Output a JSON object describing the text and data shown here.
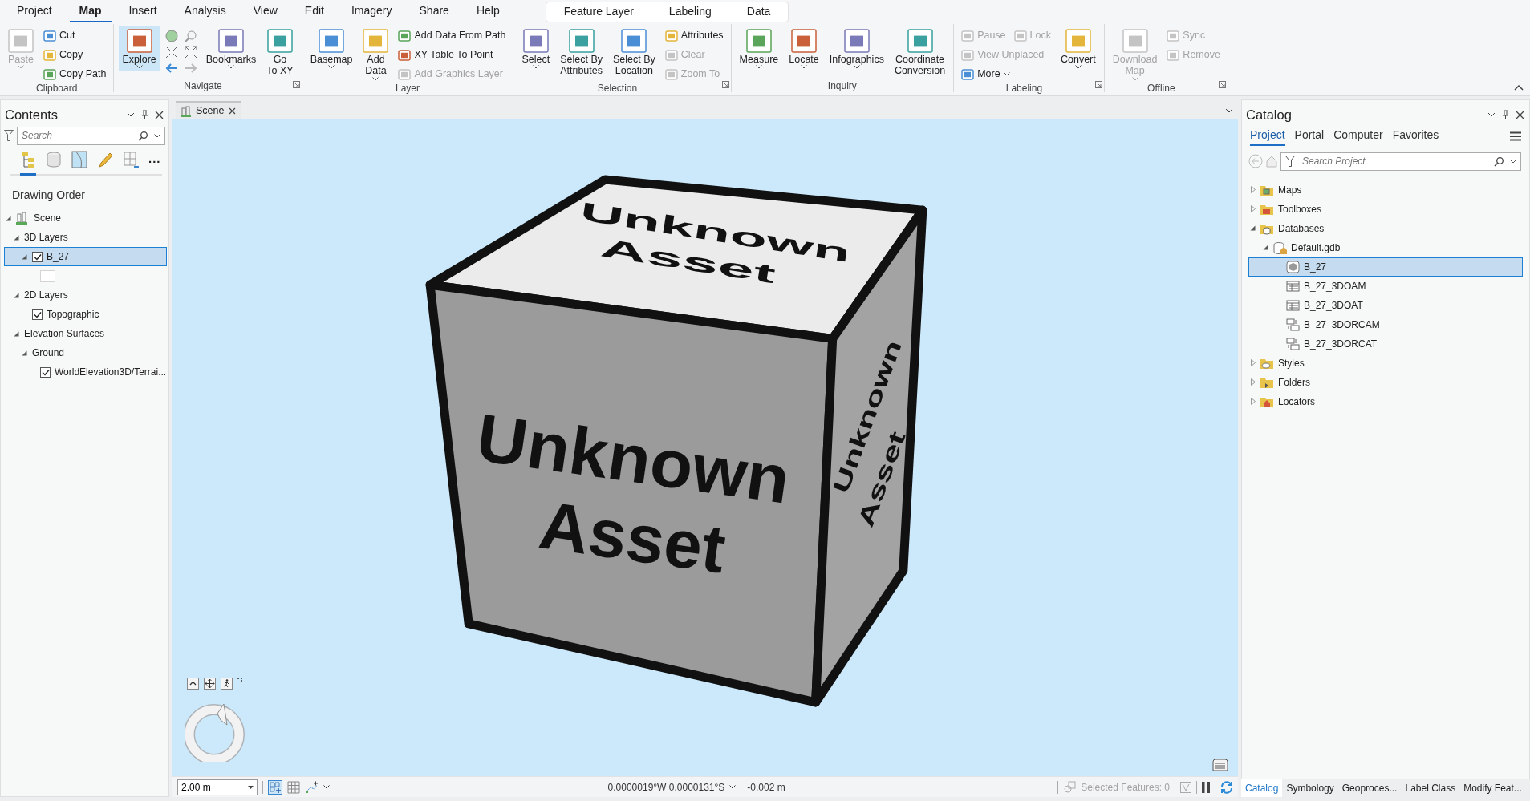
{
  "ribbon": {
    "tabs": [
      {
        "label": "Project",
        "selected": false
      },
      {
        "label": "Map",
        "selected": true
      },
      {
        "label": "Insert",
        "selected": false
      },
      {
        "label": "Analysis",
        "selected": false
      },
      {
        "label": "View",
        "selected": false
      },
      {
        "label": "Edit",
        "selected": false
      },
      {
        "label": "Imagery",
        "selected": false
      },
      {
        "label": "Share",
        "selected": false
      },
      {
        "label": "Help",
        "selected": false
      }
    ],
    "contextual_tabs": [
      {
        "label": "Feature Layer",
        "selected": false
      },
      {
        "label": "Labeling",
        "selected": false
      },
      {
        "label": "Data",
        "selected": false
      }
    ],
    "groups": [
      {
        "label": "Clipboard",
        "launcher": false,
        "controls": [
          {
            "kind": "large",
            "label": "Paste",
            "disabled": true,
            "dropdown": true,
            "active": false
          },
          {
            "kind": "stack",
            "rows": [
              [
                {
                  "label": "Cut",
                  "disabled": false,
                  "dropdown": false
                }
              ],
              [
                {
                  "label": "Copy",
                  "disabled": false,
                  "dropdown": false
                }
              ],
              [
                {
                  "label": "Copy Path",
                  "disabled": false,
                  "dropdown": false
                }
              ]
            ]
          }
        ]
      },
      {
        "label": "Navigate",
        "launcher": true,
        "controls": [
          {
            "kind": "large",
            "label": "Explore",
            "disabled": false,
            "dropdown": true,
            "active": true
          },
          {
            "kind": "nav-grid"
          },
          {
            "kind": "large",
            "label": "Bookmarks",
            "disabled": false,
            "dropdown": true,
            "active": false
          },
          {
            "kind": "large",
            "label": "Go\nTo XY",
            "disabled": false,
            "dropdown": false,
            "active": false
          }
        ]
      },
      {
        "label": "Layer",
        "launcher": false,
        "controls": [
          {
            "kind": "large",
            "label": "Basemap",
            "disabled": false,
            "dropdown": true,
            "active": false
          },
          {
            "kind": "large",
            "label": "Add\nData",
            "disabled": false,
            "dropdown": true,
            "active": false
          },
          {
            "kind": "stack",
            "rows": [
              [
                {
                  "label": "Add Data From Path",
                  "disabled": false,
                  "dropdown": false
                }
              ],
              [
                {
                  "label": "XY Table To Point",
                  "disabled": false,
                  "dropdown": false
                }
              ],
              [
                {
                  "label": "Add Graphics Layer",
                  "disabled": true,
                  "dropdown": false
                }
              ]
            ]
          }
        ]
      },
      {
        "label": "Selection",
        "launcher": true,
        "controls": [
          {
            "kind": "large",
            "label": "Select",
            "disabled": false,
            "dropdown": true,
            "active": false
          },
          {
            "kind": "large",
            "label": "Select By\nAttributes",
            "disabled": false,
            "dropdown": false,
            "active": false
          },
          {
            "kind": "large",
            "label": "Select By\nLocation",
            "disabled": false,
            "dropdown": false,
            "active": false
          },
          {
            "kind": "stack",
            "rows": [
              [
                {
                  "label": "Attributes",
                  "disabled": false,
                  "dropdown": false
                }
              ],
              [
                {
                  "label": "Clear",
                  "disabled": true,
                  "dropdown": false
                }
              ],
              [
                {
                  "label": "Zoom To",
                  "disabled": true,
                  "dropdown": false
                }
              ]
            ]
          }
        ]
      },
      {
        "label": "Inquiry",
        "launcher": false,
        "controls": [
          {
            "kind": "large",
            "label": "Measure",
            "disabled": false,
            "dropdown": true,
            "active": false
          },
          {
            "kind": "large",
            "label": "Locate",
            "disabled": false,
            "dropdown": true,
            "active": false
          },
          {
            "kind": "large",
            "label": "Infographics",
            "disabled": false,
            "dropdown": true,
            "active": false
          },
          {
            "kind": "large",
            "label": "Coordinate\nConversion",
            "disabled": false,
            "dropdown": false,
            "active": false
          }
        ]
      },
      {
        "label": "Labeling",
        "launcher": true,
        "controls": [
          {
            "kind": "stack",
            "rows": [
              [
                {
                  "label": "Pause",
                  "disabled": true,
                  "dropdown": false
                },
                {
                  "label": "Lock",
                  "disabled": true,
                  "dropdown": false
                }
              ],
              [
                {
                  "label": "View Unplaced",
                  "disabled": true,
                  "dropdown": false
                }
              ],
              [
                {
                  "label": "More",
                  "disabled": false,
                  "dropdown": true
                }
              ]
            ]
          },
          {
            "kind": "large",
            "label": "Convert",
            "disabled": false,
            "dropdown": true,
            "active": false
          }
        ]
      },
      {
        "label": "Offline",
        "launcher": true,
        "controls": [
          {
            "kind": "large",
            "label": "Download\nMap",
            "disabled": true,
            "dropdown": true,
            "active": false
          },
          {
            "kind": "stack",
            "rows": [
              [
                {
                  "label": "Sync",
                  "disabled": true,
                  "dropdown": false
                }
              ],
              [
                {
                  "label": "Remove",
                  "disabled": true,
                  "dropdown": false
                }
              ]
            ]
          }
        ]
      }
    ]
  },
  "contents": {
    "title": "Contents",
    "search": {
      "placeholder": "Search"
    },
    "view_tabs": [
      {
        "kind": "drawing-order",
        "selected": true
      },
      {
        "kind": "data-source",
        "selected": false
      },
      {
        "kind": "selection",
        "selected": false
      },
      {
        "kind": "editing",
        "selected": false
      },
      {
        "kind": "snapping",
        "selected": false
      }
    ],
    "more": "...",
    "heading": "Drawing Order",
    "tree": [
      {
        "kind": "scene",
        "label": "Scene",
        "expanded": true,
        "selected": false,
        "children": [
          {
            "label": "3D Layers",
            "expanded": true,
            "selected": false,
            "children": [
              {
                "label": "B_27",
                "expanded": true,
                "checked": true,
                "selected": true,
                "children": [
                  {
                    "kind": "swatch"
                  }
                ]
              }
            ]
          },
          {
            "label": "2D Layers",
            "expanded": true,
            "selected": false,
            "children": [
              {
                "label": "Topographic",
                "checked": true,
                "selected": false
              }
            ]
          },
          {
            "label": "Elevation Surfaces",
            "expanded": true,
            "selected": false,
            "children": [
              {
                "label": "Ground",
                "expanded": true,
                "selected": false,
                "children": [
                  {
                    "label": "WorldElevation3D/Terrai...",
                    "checked": true,
                    "selected": false
                  }
                ]
              }
            ]
          }
        ]
      }
    ]
  },
  "scene": {
    "tab": {
      "label": "Scene",
      "selected": true
    },
    "faces": [
      {
        "kind": "top",
        "lines": [
          "Unknown",
          "Asset"
        ]
      },
      {
        "kind": "front",
        "lines": [
          "Unknown",
          "Asset"
        ]
      },
      {
        "kind": "side",
        "lines": [
          "Unknown",
          "Asset"
        ]
      }
    ],
    "status_bar": {
      "scale": "2.00 m",
      "coordinates": "0.0000019°W 0.0000131°S",
      "elevation": "-0.002 m",
      "selected_features": "Selected Features: 0"
    }
  },
  "catalog": {
    "title": "Catalog",
    "tabs": [
      {
        "label": "Project",
        "selected": true
      },
      {
        "label": "Portal",
        "selected": false
      },
      {
        "label": "Computer",
        "selected": false
      },
      {
        "label": "Favorites",
        "selected": false
      }
    ],
    "search": {
      "placeholder": "Search Project"
    },
    "tree": [
      {
        "kind": "maps",
        "label": "Maps",
        "expanded": false,
        "selected": false
      },
      {
        "kind": "toolboxes",
        "label": "Toolboxes",
        "expanded": false,
        "selected": false
      },
      {
        "kind": "databases",
        "label": "Databases",
        "expanded": true,
        "selected": false,
        "children": [
          {
            "kind": "geodatabase",
            "label": "Default.gdb",
            "expanded": true,
            "selected": false,
            "children": [
              {
                "kind": "multipatch",
                "label": "B_27",
                "selected": true
              },
              {
                "kind": "table",
                "label": "B_27_3DOAM",
                "selected": false
              },
              {
                "kind": "table",
                "label": "B_27_3DOAT",
                "selected": false
              },
              {
                "kind": "relationship",
                "label": "B_27_3DORCAM",
                "selected": false
              },
              {
                "kind": "relationship",
                "label": "B_27_3DORCAT",
                "selected": false
              }
            ]
          }
        ]
      },
      {
        "kind": "styles",
        "label": "Styles",
        "expanded": false,
        "selected": false
      },
      {
        "kind": "folders",
        "label": "Folders",
        "expanded": false,
        "selected": false
      },
      {
        "kind": "locators",
        "label": "Locators",
        "expanded": false,
        "selected": false
      }
    ],
    "bottom_tabs": [
      {
        "label": "Catalog",
        "selected": true
      },
      {
        "label": "Symbology",
        "selected": false
      },
      {
        "label": "Geoproces...",
        "selected": false
      },
      {
        "label": "Label Class",
        "selected": false
      },
      {
        "label": "Modify Feat...",
        "selected": false
      }
    ]
  }
}
